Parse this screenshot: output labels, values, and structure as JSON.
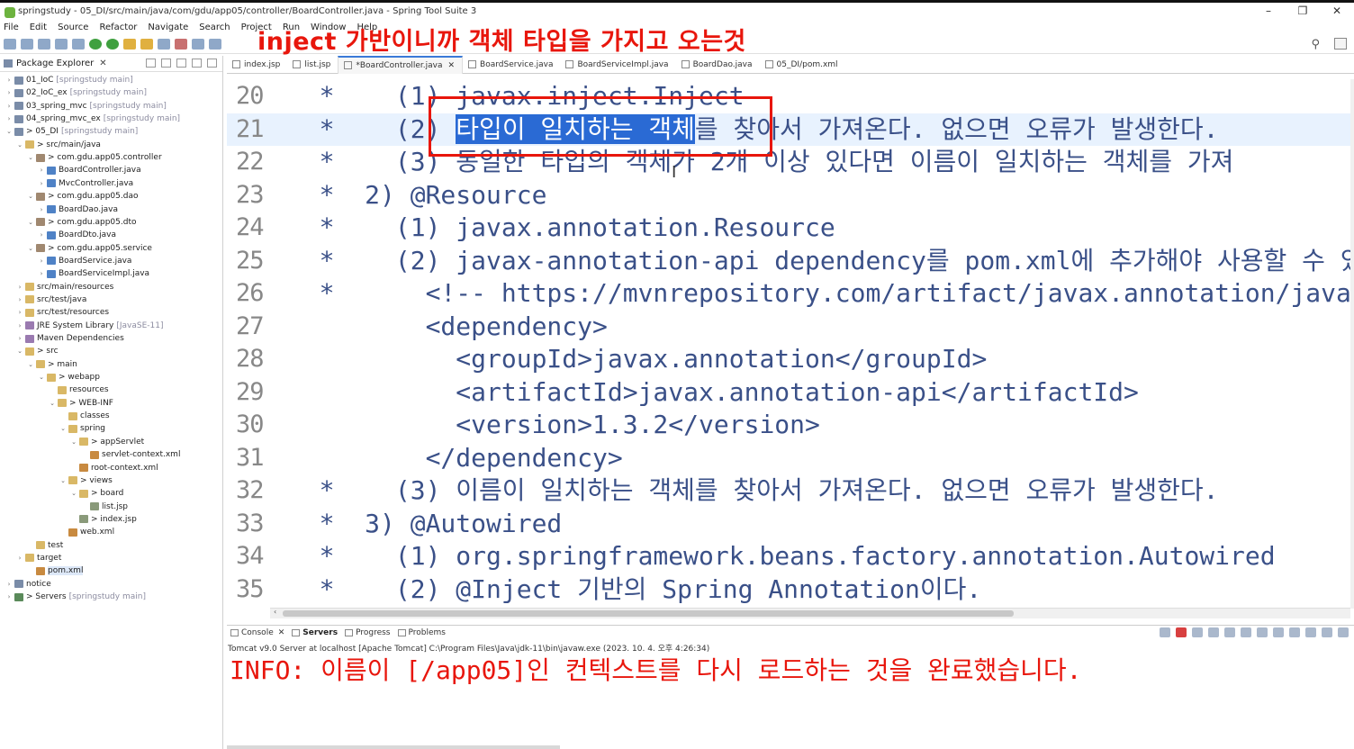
{
  "window": {
    "title": "springstudy - 05_DI/src/main/java/com/gdu/app05/controller/BoardController.java - Spring Tool Suite 3",
    "buttons": [
      "–",
      "❐",
      "✕"
    ]
  },
  "overlay_text": "inject 가반이니까 객체 타입을 가지고 오는것",
  "menu": [
    "File",
    "Edit",
    "Source",
    "Refactor",
    "Navigate",
    "Search",
    "Project",
    "Run",
    "Window",
    "Help"
  ],
  "package_explorer": {
    "title": "Package Explorer",
    "tree": [
      {
        "label": "01_IoC",
        "suffix": "[springstudy main]"
      },
      {
        "label": "02_IoC_ex",
        "suffix": "[springstudy main]"
      },
      {
        "label": "03_spring_mvc",
        "suffix": "[springstudy main]"
      },
      {
        "label": "04_spring_mvc_ex",
        "suffix": "[springstudy main]"
      },
      {
        "label": "> 05_DI",
        "suffix": "[springstudy main]"
      },
      {
        "label": "> src/main/java",
        "suffix": ""
      },
      {
        "label": "> com.gdu.app05.controller",
        "suffix": ""
      },
      {
        "label": "BoardController.java",
        "suffix": ""
      },
      {
        "label": "MvcController.java",
        "suffix": ""
      },
      {
        "label": "> com.gdu.app05.dao",
        "suffix": ""
      },
      {
        "label": "BoardDao.java",
        "suffix": ""
      },
      {
        "label": "> com.gdu.app05.dto",
        "suffix": ""
      },
      {
        "label": "BoardDto.java",
        "suffix": ""
      },
      {
        "label": "> com.gdu.app05.service",
        "suffix": ""
      },
      {
        "label": "BoardService.java",
        "suffix": ""
      },
      {
        "label": "BoardServiceImpl.java",
        "suffix": ""
      },
      {
        "label": "src/main/resources",
        "suffix": ""
      },
      {
        "label": "src/test/java",
        "suffix": ""
      },
      {
        "label": "src/test/resources",
        "suffix": ""
      },
      {
        "label": "JRE System Library",
        "suffix": "[JavaSE-11]"
      },
      {
        "label": "Maven Dependencies",
        "suffix": ""
      },
      {
        "label": "> src",
        "suffix": ""
      },
      {
        "label": "> main",
        "suffix": ""
      },
      {
        "label": "> webapp",
        "suffix": ""
      },
      {
        "label": "resources",
        "suffix": ""
      },
      {
        "label": "> WEB-INF",
        "suffix": ""
      },
      {
        "label": "classes",
        "suffix": ""
      },
      {
        "label": "spring",
        "suffix": ""
      },
      {
        "label": "> appServlet",
        "suffix": ""
      },
      {
        "label": "servlet-context.xml",
        "suffix": ""
      },
      {
        "label": "root-context.xml",
        "suffix": ""
      },
      {
        "label": "> views",
        "suffix": ""
      },
      {
        "label": "> board",
        "suffix": ""
      },
      {
        "label": "list.jsp",
        "suffix": ""
      },
      {
        "label": "> index.jsp",
        "suffix": ""
      },
      {
        "label": "web.xml",
        "suffix": ""
      },
      {
        "label": "test",
        "suffix": ""
      },
      {
        "label": "target",
        "suffix": ""
      },
      {
        "label": "pom.xml",
        "suffix": ""
      },
      {
        "label": "notice",
        "suffix": ""
      },
      {
        "label": "> Servers",
        "suffix": "[springstudy main]"
      }
    ]
  },
  "editor_tabs": [
    "index.jsp",
    "list.jsp",
    "*BoardController.java",
    "BoardService.java",
    "BoardServiceImpl.java",
    "BoardDao.java",
    "05_DI/pom.xml"
  ],
  "code_lines": [
    {
      "n": "20",
      "pre": "   *    (1) javax.inject.Inject",
      "hl": "",
      "post": ""
    },
    {
      "n": "21",
      "pre": "   *    (2) ",
      "hl": "타입이 일치하는 객체",
      "post": "를 찾아서 가져온다. 없으면 오류가 발생한다."
    },
    {
      "n": "22",
      "pre": "   *    (3) 동일한 타입의 객체가 2개 이상 있다면 이름이 일치하는 객체를 가져",
      "hl": "",
      "post": ""
    },
    {
      "n": "23",
      "pre": "   *  2) @Resource",
      "hl": "",
      "post": ""
    },
    {
      "n": "24",
      "pre": "   *    (1) javax.annotation.Resource",
      "hl": "",
      "post": ""
    },
    {
      "n": "25",
      "pre": "   *    (2) javax-annotation-api dependency를 pom.xml에 추가해야 사용할 수 있",
      "hl": "",
      "post": ""
    },
    {
      "n": "26",
      "pre": "   *      <!-- https://mvnrepository.com/artifact/javax.annotation/javax.ann",
      "hl": "",
      "post": ""
    },
    {
      "n": "27",
      "pre": "          <dependency>",
      "hl": "",
      "post": ""
    },
    {
      "n": "28",
      "pre": "            <groupId>javax.annotation</groupId>",
      "hl": "",
      "post": ""
    },
    {
      "n": "29",
      "pre": "            <artifactId>javax.annotation-api</artifactId>",
      "hl": "",
      "post": ""
    },
    {
      "n": "30",
      "pre": "            <version>1.3.2</version>",
      "hl": "",
      "post": ""
    },
    {
      "n": "31",
      "pre": "          </dependency>",
      "hl": "",
      "post": ""
    },
    {
      "n": "32",
      "pre": "   *    (3) 이름이 일치하는 객체를 찾아서 가져온다. 없으면 오류가 발생한다.",
      "hl": "",
      "post": ""
    },
    {
      "n": "33",
      "pre": "   *  3) @Autowired",
      "hl": "",
      "post": ""
    },
    {
      "n": "34",
      "pre": "   *    (1) org.springframework.beans.factory.annotation.Autowired",
      "hl": "",
      "post": ""
    },
    {
      "n": "35",
      "pre": "   *    (2) @Inject 기반의 Spring Annotation이다.",
      "hl": "",
      "post": ""
    }
  ],
  "console": {
    "tabs": [
      "Console",
      "Servers",
      "Progress",
      "Problems"
    ],
    "server_line": "Tomcat v9.0 Server at localhost [Apache Tomcat] C:\\Program Files\\Java\\jdk-11\\bin\\javaw.exe  (2023. 10. 4. 오후 4:26:34)",
    "output": "INFO: 이름이 [/app05]인 컨텍스트를 다시 로드하는 것을 완료했습니다."
  },
  "colors": {
    "accent": "#2a6ad4",
    "annotation_red": "#e8160c",
    "code": "#3a5088"
  }
}
